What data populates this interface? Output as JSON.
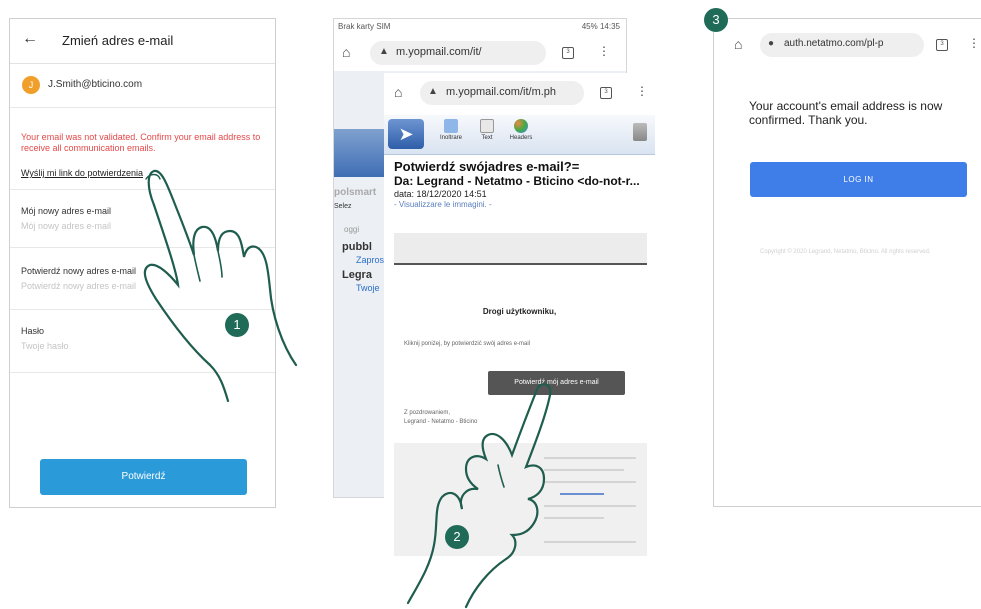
{
  "colors": {
    "accent_blue": "#2a9ad8",
    "login_blue": "#3f7ee8",
    "warning_red": "#e54848",
    "avatar_orange": "#f0a02a",
    "badge_green": "#1f6b58"
  },
  "screen1": {
    "back_icon": "arrow-left-icon",
    "title": "Zmień adres e-mail",
    "avatar_initial": "J",
    "email": "J.Smith@bticino.com",
    "warning": "Your email was not validated. Confirm your email address to receive all communication emails.",
    "resend_link": "Wyślij mi link do potwierdzenia",
    "new_email": {
      "label": "Mój nowy adres e-mail",
      "placeholder": "Mój nowy adres e-mail"
    },
    "confirm_email": {
      "label": "Potwierdź nowy adres e-mail",
      "placeholder": "Potwierdź nowy adres e-mail"
    },
    "password": {
      "label": "Hasło",
      "placeholder": "Twoje hasło"
    },
    "confirm_button": "Potwierdź"
  },
  "screen2_back": {
    "status_left": "Brak karty SIM",
    "status_right": "45%  14:35",
    "url": "m.yopmail.com/it/",
    "side_rows": [
      "polsmart",
      "Selez",
      "oggi",
      "pubbl",
      "Zapros",
      "Legra",
      "Twoje"
    ]
  },
  "screen2_front": {
    "url": "m.yopmail.com/it/m.ph",
    "toolbar": [
      "Inoltrare",
      "Text",
      "Headers"
    ],
    "subject": "Potwierdź swójadres e-mail?=",
    "from": "Da: Legrand - Netatmo - Bticino <do-not-r...",
    "date": "data: 18/12/2020 14:51",
    "show_images": "- Visualizzare le immagini. -",
    "greeting": "Drogi użytkowniku,",
    "body": "Kliknij poniżej, by potwierdzić swój adres e-mail",
    "cta_button": "Potwierdź mój adres e-mail",
    "sign_line1": "Z pozdrowaniem,",
    "sign_line2": "Legrand - Netatmo - Bticino"
  },
  "screen3": {
    "url": "auth.netatmo.com/pl-p",
    "message": "Your account's email address is now confirmed. Thank you.",
    "login_button": "LOG IN",
    "copyright": "Copyright © 2020 Legrand, Netatmo, Bticino. All rights reserved."
  },
  "steps": [
    "1",
    "2",
    "3"
  ]
}
